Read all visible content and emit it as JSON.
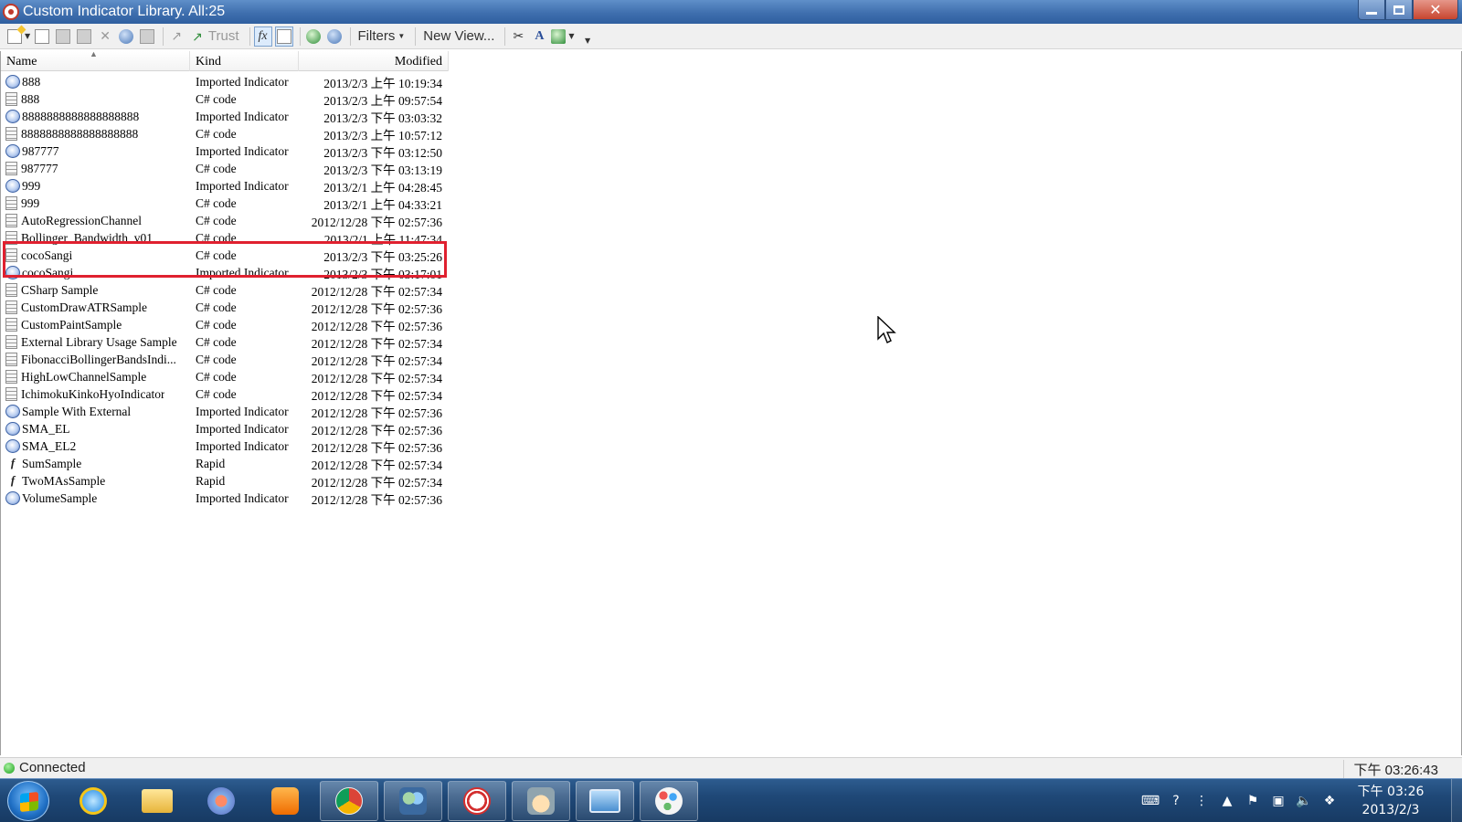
{
  "window": {
    "title": "Custom Indicator Library. All:25"
  },
  "toolbar": {
    "trust_label": "Trust",
    "filters_label": "Filters",
    "new_view_label": "New View..."
  },
  "columns": {
    "name": "Name",
    "kind": "Kind",
    "modified": "Modified"
  },
  "rows": [
    {
      "icon": "imported",
      "name": "888",
      "kind": "Imported Indicator",
      "modified": "2013/2/3 上午 10:19:34"
    },
    {
      "icon": "csharp",
      "name": "888",
      "kind": "C# code",
      "modified": "2013/2/3 上午 09:57:54"
    },
    {
      "icon": "imported",
      "name": "8888888888888888888",
      "kind": "Imported Indicator",
      "modified": "2013/2/3 下午 03:03:32"
    },
    {
      "icon": "csharp",
      "name": "8888888888888888888",
      "kind": "C# code",
      "modified": "2013/2/3 上午 10:57:12"
    },
    {
      "icon": "imported",
      "name": "987777",
      "kind": "Imported Indicator",
      "modified": "2013/2/3 下午 03:12:50"
    },
    {
      "icon": "csharp",
      "name": "987777",
      "kind": "C# code",
      "modified": "2013/2/3 下午 03:13:19"
    },
    {
      "icon": "imported",
      "name": "999",
      "kind": "Imported Indicator",
      "modified": "2013/2/1 上午 04:28:45"
    },
    {
      "icon": "csharp",
      "name": "999",
      "kind": "C# code",
      "modified": "2013/2/1 上午 04:33:21"
    },
    {
      "icon": "csharp",
      "name": "AutoRegressionChannel",
      "kind": "C# code",
      "modified": "2012/12/28 下午 02:57:36"
    },
    {
      "icon": "csharp",
      "name": "Bollinger_Bandwidth_v01",
      "kind": "C# code",
      "modified": "2013/2/1 上午 11:47:34"
    },
    {
      "icon": "csharp",
      "name": "cocoSangi",
      "kind": "C# code",
      "modified": "2013/2/3 下午 03:25:26"
    },
    {
      "icon": "imported",
      "name": "cocoSangi",
      "kind": "Imported Indicator",
      "modified": "2013/2/3 下午 03:17:01"
    },
    {
      "icon": "csharp",
      "name": "CSharp Sample",
      "kind": "C# code",
      "modified": "2012/12/28 下午 02:57:34"
    },
    {
      "icon": "csharp",
      "name": "CustomDrawATRSample",
      "kind": "C# code",
      "modified": "2012/12/28 下午 02:57:36"
    },
    {
      "icon": "csharp",
      "name": "CustomPaintSample",
      "kind": "C# code",
      "modified": "2012/12/28 下午 02:57:36"
    },
    {
      "icon": "csharp",
      "name": "External Library Usage Sample",
      "kind": "C# code",
      "modified": "2012/12/28 下午 02:57:34"
    },
    {
      "icon": "csharp",
      "name": "FibonacciBollingerBandsIndi...",
      "kind": "C# code",
      "modified": "2012/12/28 下午 02:57:34"
    },
    {
      "icon": "csharp",
      "name": "HighLowChannelSample",
      "kind": "C# code",
      "modified": "2012/12/28 下午 02:57:34"
    },
    {
      "icon": "csharp",
      "name": "IchimokuKinkoHyoIndicator",
      "kind": "C# code",
      "modified": "2012/12/28 下午 02:57:34"
    },
    {
      "icon": "imported",
      "name": "Sample With External",
      "kind": "Imported Indicator",
      "modified": "2012/12/28 下午 02:57:36"
    },
    {
      "icon": "imported",
      "name": "SMA_EL",
      "kind": "Imported Indicator",
      "modified": "2012/12/28 下午 02:57:36"
    },
    {
      "icon": "imported",
      "name": "SMA_EL2",
      "kind": "Imported Indicator",
      "modified": "2012/12/28 下午 02:57:36"
    },
    {
      "icon": "rapid",
      "name": "SumSample",
      "kind": "Rapid",
      "modified": "2012/12/28 下午 02:57:34"
    },
    {
      "icon": "rapid",
      "name": "TwoMAsSample",
      "kind": "Rapid",
      "modified": "2012/12/28 下午 02:57:34"
    },
    {
      "icon": "imported",
      "name": "VolumeSample",
      "kind": "Imported Indicator",
      "modified": "2012/12/28 下午 02:57:36"
    }
  ],
  "statusbar": {
    "status": "Connected",
    "time": "下午 03:26:43"
  },
  "taskbar": {
    "clock_time": "下午 03:26",
    "clock_date": "2013/2/3"
  },
  "colors": {
    "highlight_box": "#e0202f",
    "titlebar": "#3f6fae",
    "status_connected": "#1aa11a"
  }
}
